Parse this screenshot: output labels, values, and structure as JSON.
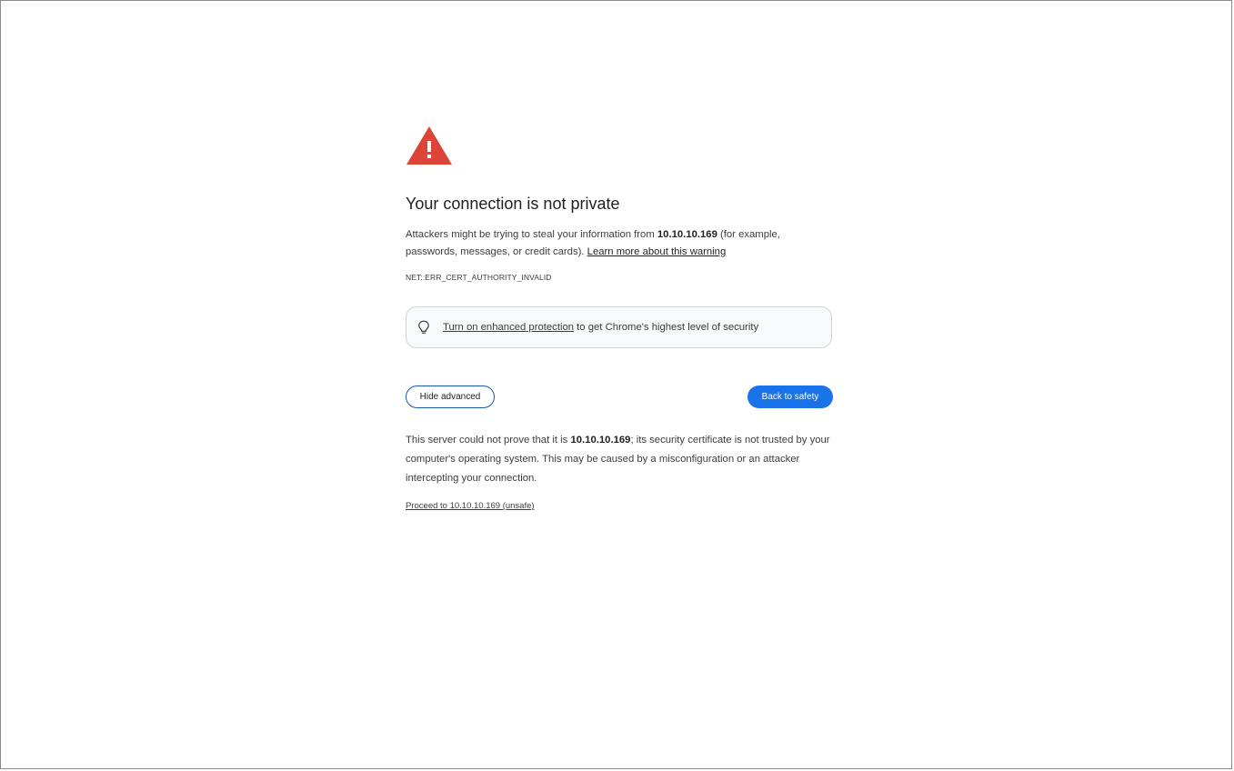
{
  "page": {
    "title": "Your connection is not private",
    "intro": {
      "part1": "Attackers might be trying to steal your information from ",
      "host": "10.10.10.169",
      "part2": " (for example, passwords, messages, or credit cards). ",
      "learn_more": "Learn more about this warning"
    },
    "error_code": "NET::ERR_CERT_AUTHORITY_INVALID",
    "enhanced_protection": {
      "link": "Turn on enhanced protection",
      "rest": " to get Chrome's highest level of security"
    },
    "buttons": {
      "hide_advanced": "Hide advanced",
      "back_to_safety": "Back to safety"
    },
    "details": {
      "part1": "This server could not prove that it is ",
      "host": "10.10.10.169",
      "part2": "; its security certificate is not trusted by your computer's operating system. This may be caused by a misconfiguration or an attacker intercepting your connection."
    },
    "proceed_link": "Proceed to 10.10.10.169 (unsafe)"
  },
  "colors": {
    "warning_red": "#db4437",
    "primary_blue": "#1a73e8",
    "outline_blue": "#1a56b8"
  },
  "icons": {
    "warning": "warning-triangle-icon",
    "bulb": "lightbulb-icon"
  }
}
